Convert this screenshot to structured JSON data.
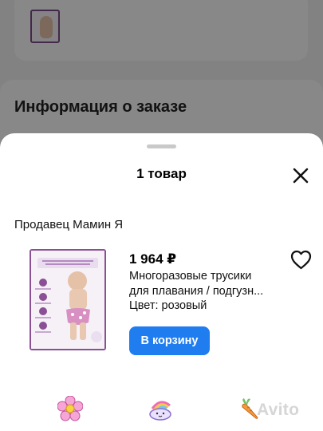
{
  "background": {
    "section_title": "Информация о заказе"
  },
  "sheet": {
    "title": "1 товар",
    "seller": "Продавец Мамин Я",
    "product": {
      "price": "1 964 ₽",
      "name_line1": "Многоразовые трусики",
      "name_line2": "для плавания / подгузн...",
      "color": "Цвет: розовый",
      "add_to_cart_label": "В корзину"
    },
    "watermark": "Avito"
  },
  "colors": {
    "accent": "#1f7df0",
    "product_frame": "#8b4f95"
  },
  "icons": [
    "close-icon",
    "heart-outline-icon",
    "flower-icon",
    "cloud-rainbow-icon",
    "carrot-icon"
  ]
}
